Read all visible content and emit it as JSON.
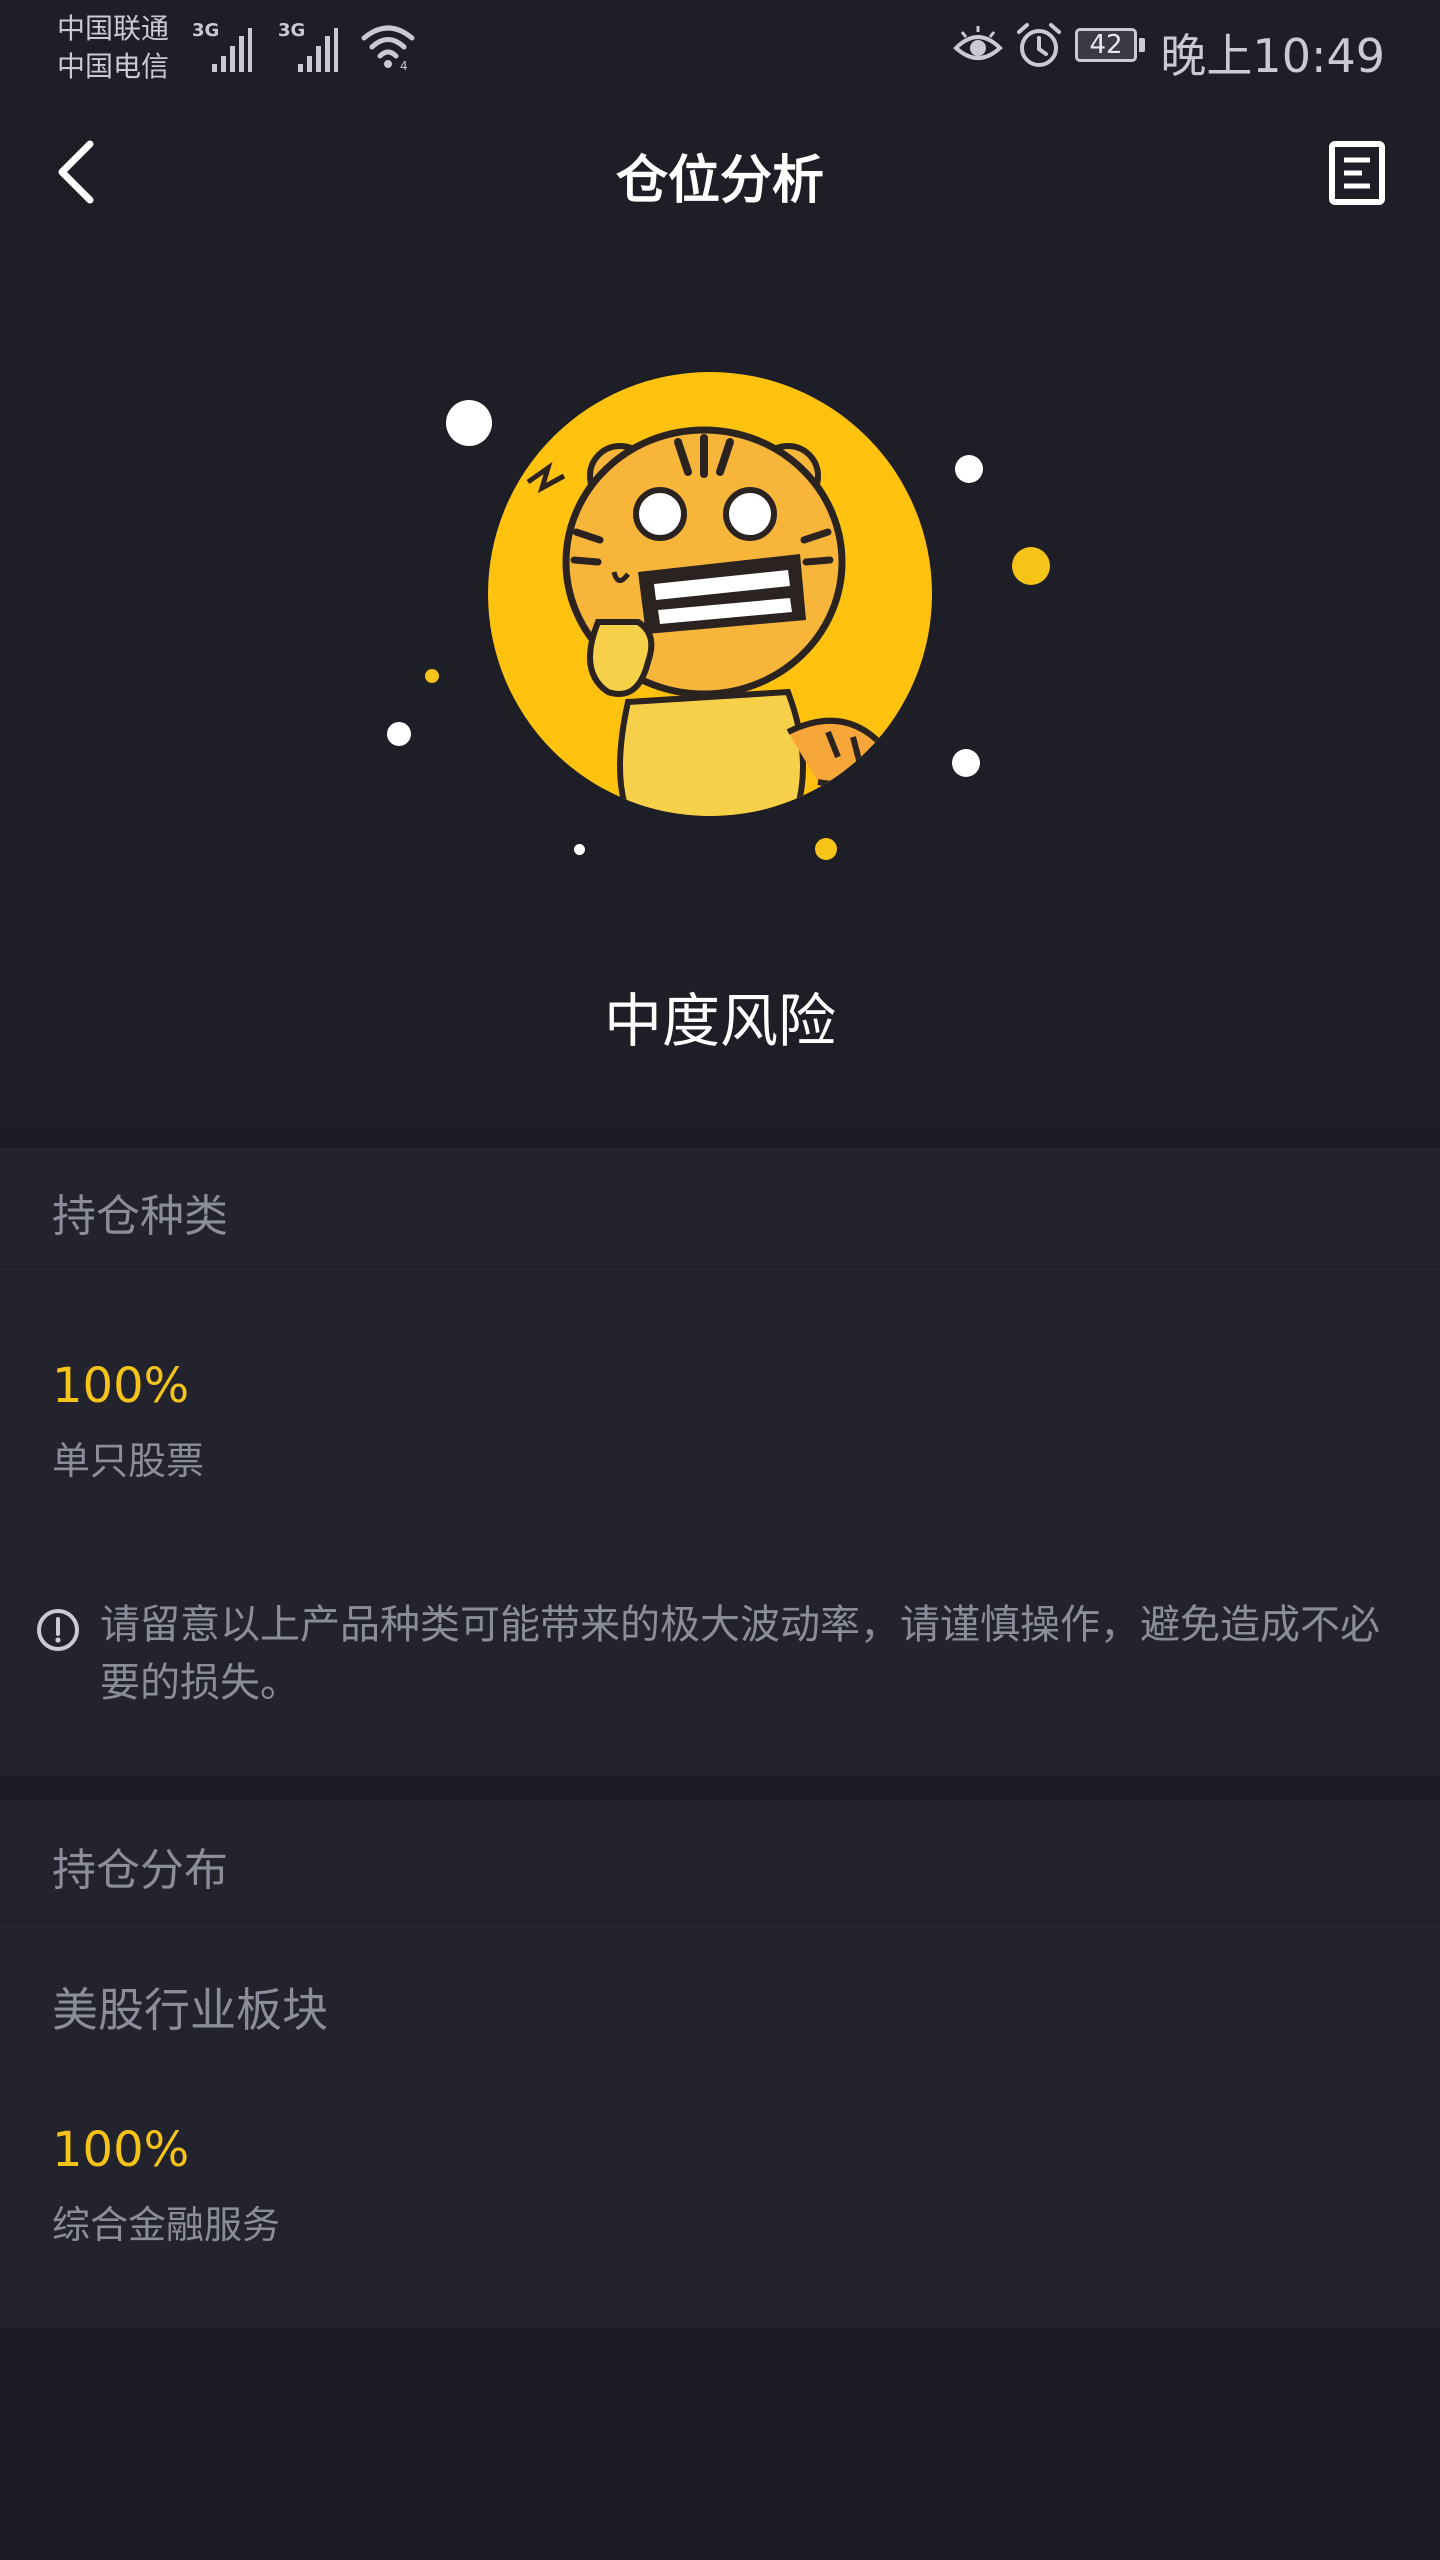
{
  "status_bar": {
    "carrier_1": "中国联通",
    "carrier_2": "中国电信",
    "network_1": "3G",
    "network_2": "3G",
    "battery": "42",
    "time": "晚上10:49"
  },
  "header": {
    "title": "仓位分析",
    "back_icon": "chevron-left-icon",
    "report_icon": "document-icon"
  },
  "hero": {
    "mascot": "tiger-mascot-image",
    "risk_level": "中度风险"
  },
  "holding_types": {
    "title": "持仓种类",
    "items": [
      {
        "percent": "100%",
        "label": "单只股票"
      }
    ],
    "warning": "请留意以上产品种类可能带来的极大波动率，请谨慎操作，避免造成不必要的损失。"
  },
  "holding_distribution": {
    "title": "持仓分布",
    "sector_title": "美股行业板块",
    "items": [
      {
        "percent": "100%",
        "label": "综合金融服务"
      }
    ]
  },
  "colors": {
    "background": "#1b1b23",
    "panel": "#22232d",
    "accent": "#f6c419",
    "muted_text": "#8b8d9a"
  }
}
